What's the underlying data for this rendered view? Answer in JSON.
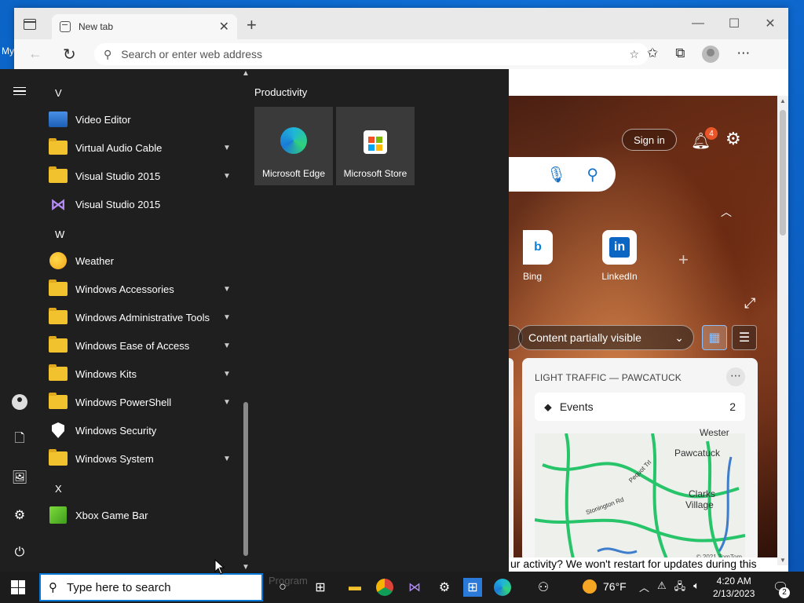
{
  "desktop": {
    "label": "My"
  },
  "browser": {
    "tab_title": "New tab",
    "search_placeholder": "Search or enter web address",
    "ntp": {
      "signin_label": "Sign in",
      "notification_count": "4",
      "quick_links": [
        {
          "label": "Bing"
        },
        {
          "label": "LinkedIn"
        }
      ],
      "content_dropdown": "Content partially visible",
      "traffic_card": {
        "title": "LIGHT TRAFFIC — PAWCATUCK",
        "events_label": "Events",
        "events_count": "2",
        "map_labels": [
          "Wester",
          "Pawcatuck",
          "Clarks",
          "Village",
          "Stonington Rd",
          "Pequot Trl"
        ],
        "copyright": "© 2021 TomTom"
      },
      "notify_text": "ur activity? We won't restart for updates during this"
    }
  },
  "startmenu": {
    "apps": [
      {
        "type": "letter",
        "label": "V"
      },
      {
        "type": "app",
        "icon": "video-editor-icon",
        "label": "Video Editor",
        "expand": false
      },
      {
        "type": "folder",
        "label": "Virtual Audio Cable",
        "expand": true
      },
      {
        "type": "folder",
        "label": "Visual Studio 2015",
        "expand": true
      },
      {
        "type": "app",
        "icon": "visual-studio-icon",
        "label": "Visual Studio 2015",
        "expand": false
      },
      {
        "type": "letter",
        "label": "W"
      },
      {
        "type": "app",
        "icon": "weather-icon",
        "label": "Weather",
        "expand": false
      },
      {
        "type": "folder",
        "label": "Windows Accessories",
        "expand": true
      },
      {
        "type": "folder",
        "label": "Windows Administrative Tools",
        "expand": true
      },
      {
        "type": "folder",
        "label": "Windows Ease of Access",
        "expand": true
      },
      {
        "type": "folder",
        "label": "Windows Kits",
        "expand": true
      },
      {
        "type": "folder",
        "label": "Windows PowerShell",
        "expand": true
      },
      {
        "type": "app",
        "icon": "shield-icon",
        "label": "Windows Security",
        "expand": false
      },
      {
        "type": "folder",
        "label": "Windows System",
        "expand": true
      },
      {
        "type": "letter",
        "label": "X"
      },
      {
        "type": "app",
        "icon": "xbox-game-bar-icon",
        "label": "Xbox Game Bar",
        "expand": false
      }
    ],
    "tiles_group": "Productivity",
    "tiles": [
      {
        "label": "Microsoft Edge"
      },
      {
        "label": "Microsoft Store"
      }
    ]
  },
  "taskbar": {
    "search_placeholder": "Type here to search",
    "ghost_text": "Program",
    "weather": "76°F",
    "time": "4:20 AM",
    "date": "2/13/2023",
    "notification_count": "2"
  }
}
